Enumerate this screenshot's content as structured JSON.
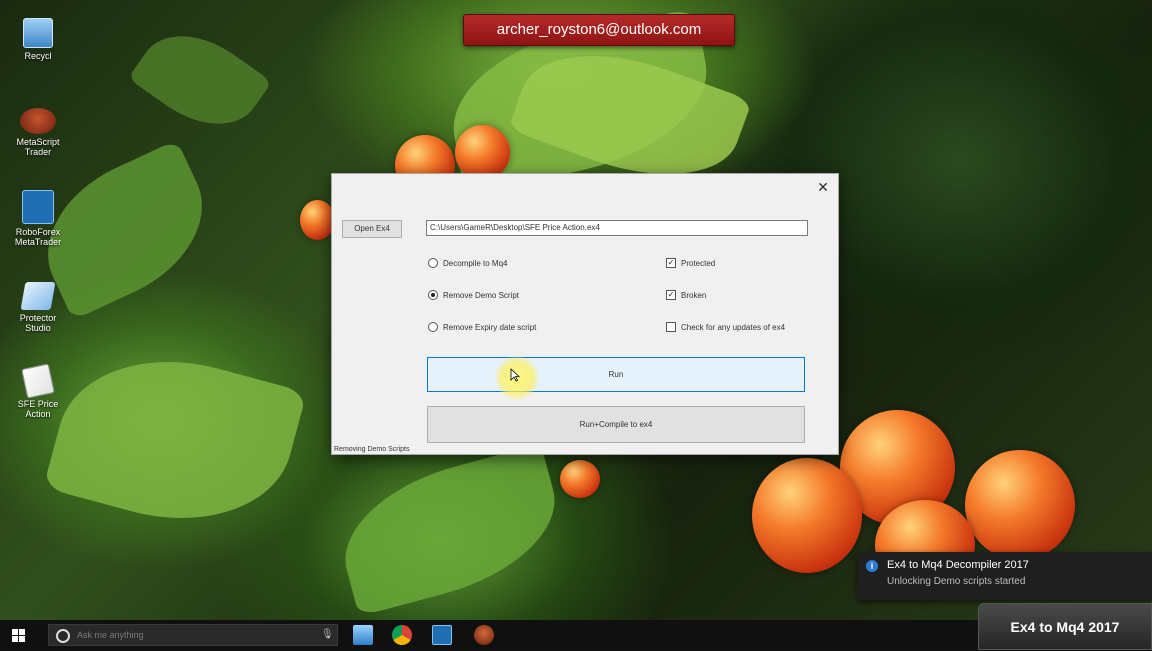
{
  "email_banner": "archer_royston6@outlook.com",
  "desktop_icons": [
    {
      "label": "Recycl",
      "icon": "recycle-bin-icon"
    },
    {
      "label": "MetaScript Trader",
      "icon": "metascript-icon"
    },
    {
      "label": "RoboForex MetaTrader",
      "icon": "metatrader-icon"
    },
    {
      "label": "Protector Studio",
      "icon": "protector-icon"
    },
    {
      "label": "SFE Price Action",
      "icon": "price-action-icon"
    }
  ],
  "app": {
    "open_button": "Open Ex4",
    "path_value": "C:\\Users\\GameR\\Desktop\\SFE Price Action.ex4",
    "options": {
      "decompile": "Decompile to Mq4",
      "remove_demo": "Remove Demo Script",
      "remove_expiry": "Remove Expiry date script",
      "protected": "Protected",
      "broken": "Broken",
      "check_updates": "Check for any updates of ex4"
    },
    "selected_radio": "remove_demo",
    "checked": {
      "protected": true,
      "broken": true,
      "check_updates": false
    },
    "run_button": "Run",
    "run_compile_button": "Run+Compile to ex4",
    "status": "Removing Demo Scripts",
    "close_glyph": "✕"
  },
  "toast": {
    "title": "Ex4 to Mq4 Decompiler 2017",
    "message": "Unlocking Demo scripts started",
    "icon": "info-icon"
  },
  "taskbar": {
    "search_placeholder": "Ask me anything",
    "apps": [
      "file-manager-icon",
      "chrome-icon",
      "metatrader-icon",
      "metascript-icon"
    ],
    "brand": "Ex4 to Mq4 2017"
  },
  "colors": {
    "banner": "#a32020",
    "accent": "#0078d7",
    "taskbar": "#101010",
    "toast": "#1f1f1f"
  }
}
